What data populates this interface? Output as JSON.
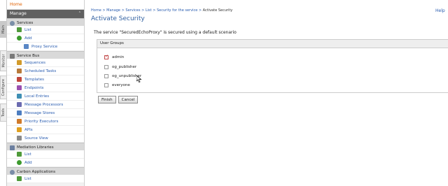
{
  "side_tabs": [
    "Main",
    "Monitor",
    "Configure",
    "Tools"
  ],
  "nav": {
    "home": "Home",
    "manage": "Manage",
    "sections": {
      "services": "Services",
      "service_bus": "Service Bus",
      "mediation_libraries": "Mediation Libraries",
      "carbon_applications": "Carbon Applications"
    },
    "services_items": [
      "List",
      "Add",
      "Proxy Service"
    ],
    "bus_items": [
      "Sequences",
      "Scheduled Tasks",
      "Templates",
      "Endpoints",
      "Local Entries",
      "Message Processors",
      "Message Stores",
      "Priority Executors",
      "APIs",
      "Source View"
    ],
    "lib_items": [
      "List",
      "Add"
    ],
    "carbon_items": [
      "List"
    ]
  },
  "breadcrumb": [
    "Home",
    "Manage",
    "Services",
    "List",
    "Security for the service",
    "Activate Security"
  ],
  "help": "Help",
  "page_title": "Activate Security",
  "notice": "The service \"SecuredEchoProxy\" is secured using a default scenario",
  "user_groups": {
    "heading": "User Groups",
    "items": [
      {
        "label": "admin",
        "checked": true
      },
      {
        "label": "og_publisher",
        "checked": false
      },
      {
        "label": "og_unpublisher",
        "checked": false
      },
      {
        "label": "everyone",
        "checked": false
      }
    ]
  },
  "buttons": {
    "finish": "Finish",
    "cancel": "Cancel"
  },
  "colors": {
    "title": "#2f5fa0",
    "link": "#2a5db0",
    "home": "#e06000",
    "manage_bar": "#606060"
  }
}
